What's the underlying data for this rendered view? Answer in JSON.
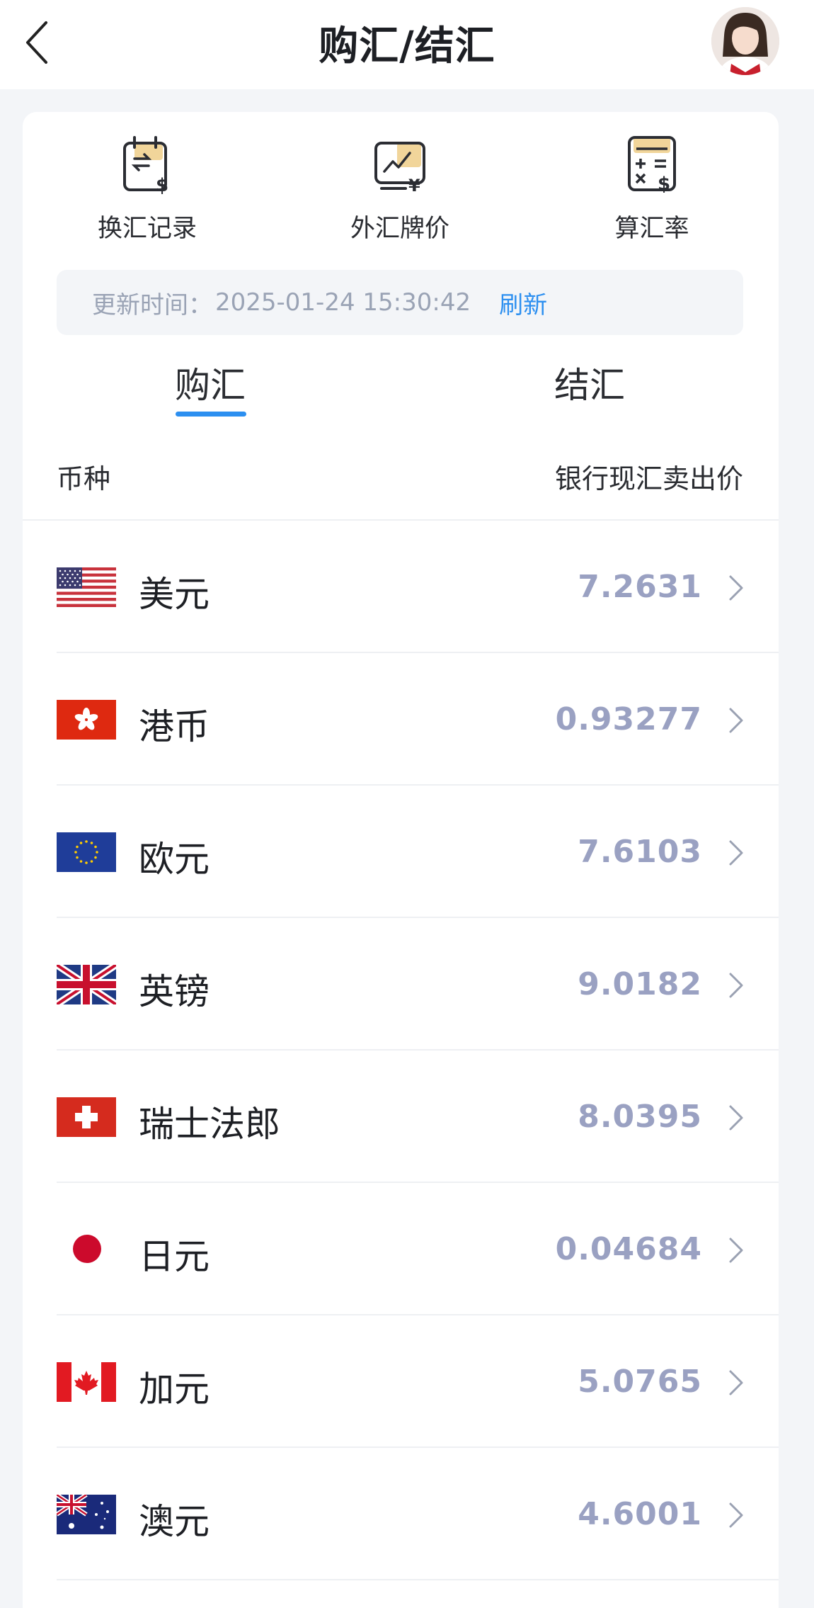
{
  "header": {
    "title": "购汇/结汇",
    "back_icon": "chevron-left-icon",
    "avatar": "assistant-avatar"
  },
  "quick_entries": [
    {
      "label": "换汇记录",
      "icon": "exchange-record-icon"
    },
    {
      "label": "外汇牌价",
      "icon": "fx-quote-icon"
    },
    {
      "label": "算汇率",
      "icon": "calculator-icon"
    }
  ],
  "update": {
    "label": "更新时间：",
    "time": "2025-01-24 15:30:42",
    "refresh_label": "刷新"
  },
  "tabs": [
    {
      "label": "购汇",
      "active": true
    },
    {
      "label": "结汇",
      "active": false
    }
  ],
  "table": {
    "col_currency": "币种",
    "col_rate": "银行现汇卖出价",
    "rows": [
      {
        "name": "美元",
        "rate": "7.2631",
        "flag": "us-flag"
      },
      {
        "name": "港币",
        "rate": "0.93277",
        "flag": "hk-flag"
      },
      {
        "name": "欧元",
        "rate": "7.6103",
        "flag": "eu-flag"
      },
      {
        "name": "英镑",
        "rate": "9.0182",
        "flag": "uk-flag"
      },
      {
        "name": "瑞士法郎",
        "rate": "8.0395",
        "flag": "ch-flag"
      },
      {
        "name": "日元",
        "rate": "0.04684",
        "flag": "jp-flag"
      },
      {
        "name": "加元",
        "rate": "5.0765",
        "flag": "ca-flag"
      },
      {
        "name": "澳元",
        "rate": "4.6001",
        "flag": "au-flag"
      }
    ]
  },
  "colors": {
    "accent": "#2c8ff0",
    "rate_text": "#9aa1c2",
    "background": "#f3f5f8"
  }
}
